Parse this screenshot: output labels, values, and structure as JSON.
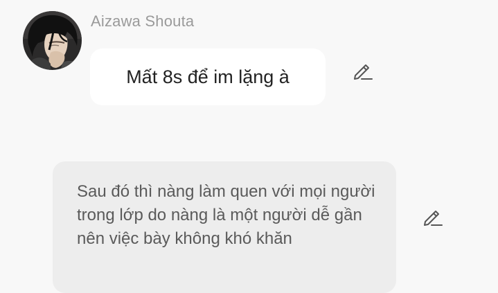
{
  "conversation": {
    "sender": {
      "name": "Aizawa Shouta",
      "avatar_icon": "character-avatar"
    },
    "messages": [
      {
        "text": "Mất 8s để im lặng à",
        "style": "dialogue",
        "bubble_color": "#ffffff",
        "action_icon": "pencil-edit-icon"
      },
      {
        "text": "Sau đó thì nàng làm quen với mọi người trong lớp do nàng là một người dễ gần nên việc bày không khó khăn",
        "style": "narration",
        "bubble_color": "#ededed",
        "action_icon": "pencil-edit-icon"
      }
    ]
  },
  "colors": {
    "background": "#f8f8f8",
    "sender_name": "#9a9a9a",
    "dialogue_text": "#222222",
    "narration_text": "#5a5a5a",
    "icon": "#555555"
  }
}
